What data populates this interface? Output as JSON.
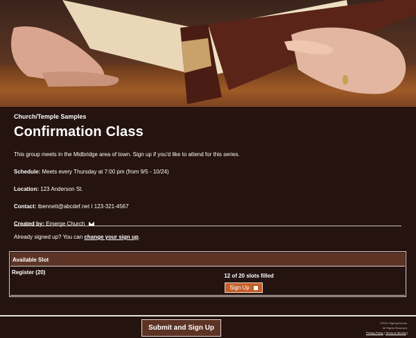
{
  "hero": {
    "image": "open-book-photo"
  },
  "group": {
    "group_name": "Church/Temple Samples",
    "title": "Confirmation Class",
    "description": "This group meets in the Midbridge area of town. Sign up if you'd like to attend for this series."
  },
  "details": {
    "schedule_label": "Schedule:",
    "schedule_value": "Meets every Thursday at 7:00 pm (from 9/5 - 10/24)",
    "location_label": "Location:",
    "location_value": "123 Anderson St.",
    "contact_label": "Contact:",
    "contact_value": "tbennett@abcdef.net I 123-321-4567",
    "created_label": "Created by:",
    "created_value": "Emerge Church"
  },
  "already": {
    "prefix": "Already signed up? You can",
    "link": "change your sign up",
    "suffix": "."
  },
  "slots": {
    "header": "Available Slot",
    "row_name": "Register (20)",
    "filled": "12 of 20 slots filled",
    "signup_label": "Sign Up"
  },
  "footer": {
    "submit_label": "Submit and Sign Up",
    "copyright_line1": "©2021 SignUpGenius.",
    "copyright_line2": "All Rights Reserved.",
    "privacy": "Privacy Policy",
    "separator": "|",
    "terms": "Terms of Service",
    "trail": "|"
  },
  "colors": {
    "background": "#24130f",
    "header_bar": "#5c3325",
    "accent_button": "#c45f2a"
  }
}
